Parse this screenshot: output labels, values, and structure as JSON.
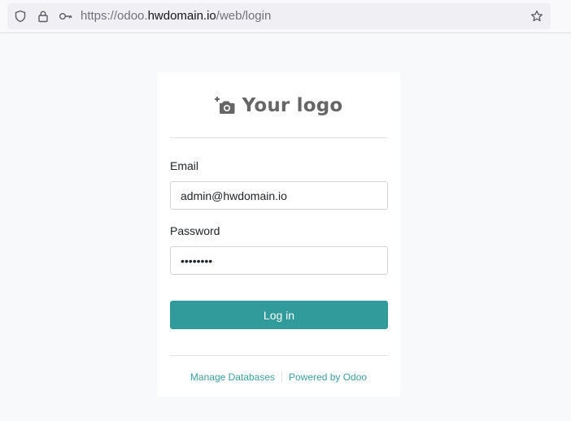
{
  "browser": {
    "url_prefix": "https://odoo.",
    "url_host": "hwdomain.io",
    "url_path": "/web/login"
  },
  "login": {
    "logo_text": "Your logo",
    "email_label": "Email",
    "email_value": "admin@hwdomain.io",
    "password_label": "Password",
    "password_value": "secretpw",
    "login_button": "Log in"
  },
  "footer": {
    "manage_databases": "Manage Databases",
    "powered_by": "Powered by Odoo"
  },
  "colors": {
    "primary": "#319a9b",
    "link": "#3a9ea0"
  }
}
